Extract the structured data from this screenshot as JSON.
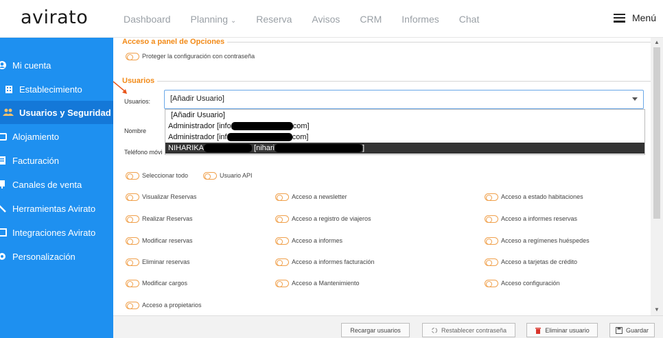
{
  "header": {
    "logo": "avirato",
    "nav": [
      "Dashboard",
      "Planning",
      "Reserva",
      "Avisos",
      "CRM",
      "Informes",
      "Chat"
    ],
    "menu_label": "Menú"
  },
  "sidebar": {
    "items": [
      {
        "label": "Mi cuenta",
        "icon": "user-circle-icon"
      },
      {
        "label": "Establecimiento",
        "icon": "building-icon"
      },
      {
        "label": "Usuarios y Seguridad",
        "icon": "users-icon"
      },
      {
        "label": "Alojamiento",
        "icon": "bed-icon"
      },
      {
        "label": "Facturación",
        "icon": "invoice-icon"
      },
      {
        "label": "Canales de venta",
        "icon": "channel-icon"
      },
      {
        "label": "Herramientas Avirato",
        "icon": "tools-icon"
      },
      {
        "label": "Integraciones Avirato",
        "icon": "integration-icon"
      },
      {
        "label": "Personalización",
        "icon": "gear-icon"
      }
    ],
    "active": "Usuarios y Seguridad"
  },
  "panel": {
    "options_legend": "Acceso a panel de Opciones",
    "protect_label": "Proteger la configuración con contraseña",
    "users_legend": "Usuarios",
    "users_label": "Usuarios:",
    "select_value": "[Añadir Usuario]",
    "dropdown": [
      {
        "text": "[Añadir Usuario]"
      },
      {
        "prefix": "Administrador [info",
        "suffix": "com]"
      },
      {
        "prefix": "Administrador [inf",
        "suffix": "com]"
      },
      {
        "prefix": "NIHARIKA",
        "mid": "[nihari",
        "suffix": "]"
      }
    ],
    "nombre_label": "Nombre",
    "telefono_label": "Teléfono móvi",
    "select_all": "Seleccionar todo",
    "api_user": "Usuario API",
    "permissions": [
      "Visualizar Reservas",
      "Acceso a newsletter",
      "Acceso a estado habitaciones",
      "Realizar Reservas",
      "Acceso a registro de viajeros",
      "Acceso a informes reservas",
      "Modificar reservas",
      "Acceso a informes",
      "Acceso a regímenes huéspedes",
      "Eliminar reservas",
      "Acceso a informes facturación",
      "Acceso a tarjetas de crédito",
      "Modificar cargos",
      "Acceso a Mantenimiento",
      "Acceso configuración",
      "Acceso a propietarios"
    ]
  },
  "footer": {
    "reload": "Recargar usuarios",
    "reset": "Restablecer contraseña",
    "delete": "Eliminar usuario",
    "save": "Guardar"
  },
  "colors": {
    "sidebar": "#1e90f0",
    "accent": "#f28a17"
  }
}
